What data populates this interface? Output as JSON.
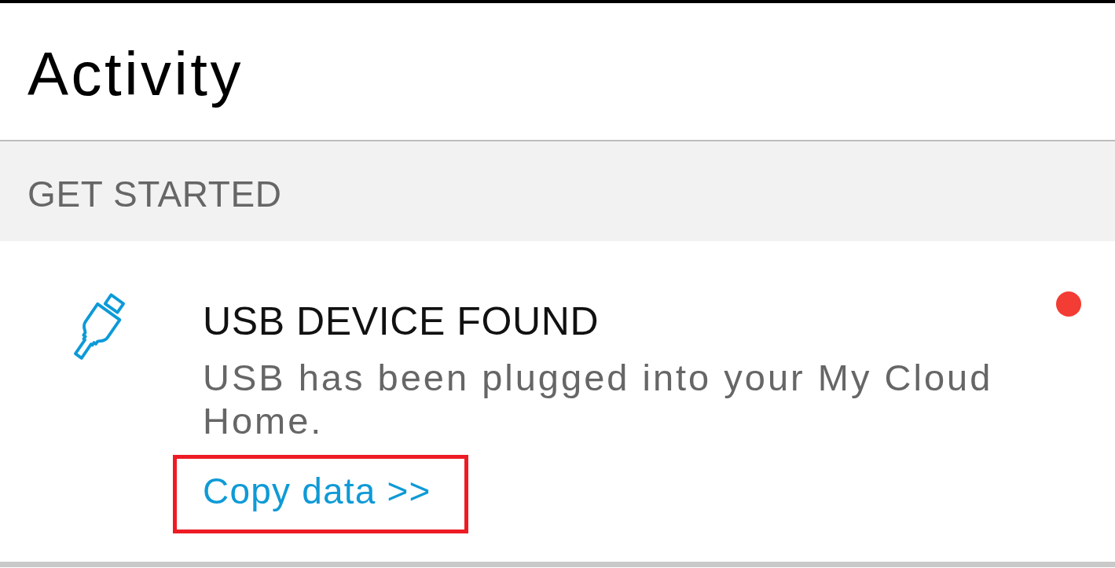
{
  "screen": {
    "title": "Activity"
  },
  "sections": [
    {
      "heading": "GET STARTED",
      "items": [
        {
          "kind": "usb",
          "title": "USB DEVICE FOUND",
          "description": "USB has been plugged into your My Cloud Home.",
          "action": {
            "label": "Copy data >>",
            "highlighted": true
          },
          "unread": true
        }
      ]
    }
  ]
}
